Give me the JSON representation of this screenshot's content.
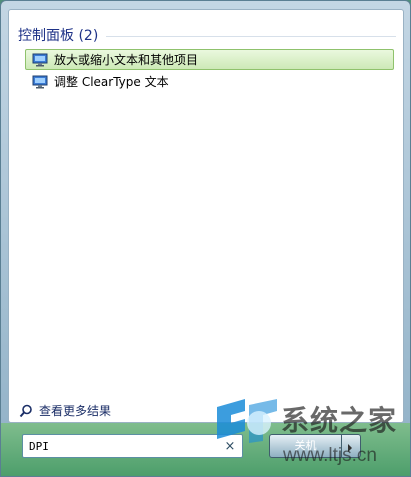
{
  "results": {
    "group_title": "控制面板 (2)",
    "items": [
      {
        "label": "放大或缩小文本和其他项目",
        "icon": "display-settings-icon",
        "selected": true
      },
      {
        "label": "调整 ClearType 文本",
        "icon": "display-settings-icon",
        "selected": false
      }
    ]
  },
  "see_more": {
    "label": "查看更多结果",
    "icon": "search-icon"
  },
  "search": {
    "value": "DPI",
    "clear_label": "×"
  },
  "shutdown": {
    "label": "关机"
  },
  "watermark": {
    "text": "系统之家",
    "url": "www.ltjs.cn"
  },
  "colors": {
    "group_title": "#1e3287",
    "selection_fill": "#cde9b7",
    "selection_border": "#8fc26c",
    "bottom_strip": "#4b9d6a"
  }
}
